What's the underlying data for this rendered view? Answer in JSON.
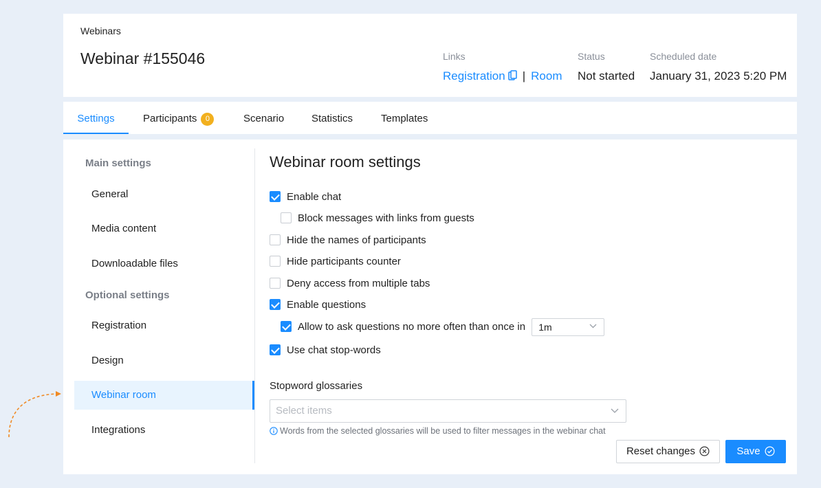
{
  "header": {
    "breadcrumb": "Webinars",
    "title": "Webinar #155046",
    "links_label": "Links",
    "registration_link": "Registration",
    "link_separator": "|",
    "room_link": "Room",
    "status_label": "Status",
    "status_value": "Not started",
    "date_label": "Scheduled date",
    "date_value": "January 31, 2023 5:20 PM"
  },
  "tabs": {
    "settings": "Settings",
    "participants": "Participants",
    "participants_count": "0",
    "scenario": "Scenario",
    "statistics": "Statistics",
    "templates": "Templates",
    "active": "Settings"
  },
  "sidebar": {
    "main_heading": "Main settings",
    "general": "General",
    "media": "Media content",
    "downloads": "Downloadable files",
    "optional_heading": "Optional settings",
    "registration": "Registration",
    "design": "Design",
    "webinar_room": "Webinar room",
    "integrations": "Integrations",
    "active": "Webinar room"
  },
  "content": {
    "title": "Webinar room settings",
    "options": {
      "enable_chat": "Enable chat",
      "block_links": "Block messages with links from guests",
      "hide_names": "Hide the names of participants",
      "hide_counter": "Hide participants counter",
      "deny_tabs": "Deny access from multiple tabs",
      "enable_questions": "Enable questions",
      "limit_questions": "Allow to ask questions no more often than once in",
      "stop_words": "Use chat stop-words"
    },
    "question_interval": "1m",
    "glossary_label": "Stopword glossaries",
    "glossary_placeholder": "Select items",
    "glossary_hint": "Words from the selected glossaries will be used to filter messages in the webinar chat",
    "reset_label": "Reset changes",
    "save_label": "Save"
  },
  "colors": {
    "accent": "#1a8cff",
    "badge": "#f2b01e",
    "decor_arrow": "#f08a24"
  }
}
